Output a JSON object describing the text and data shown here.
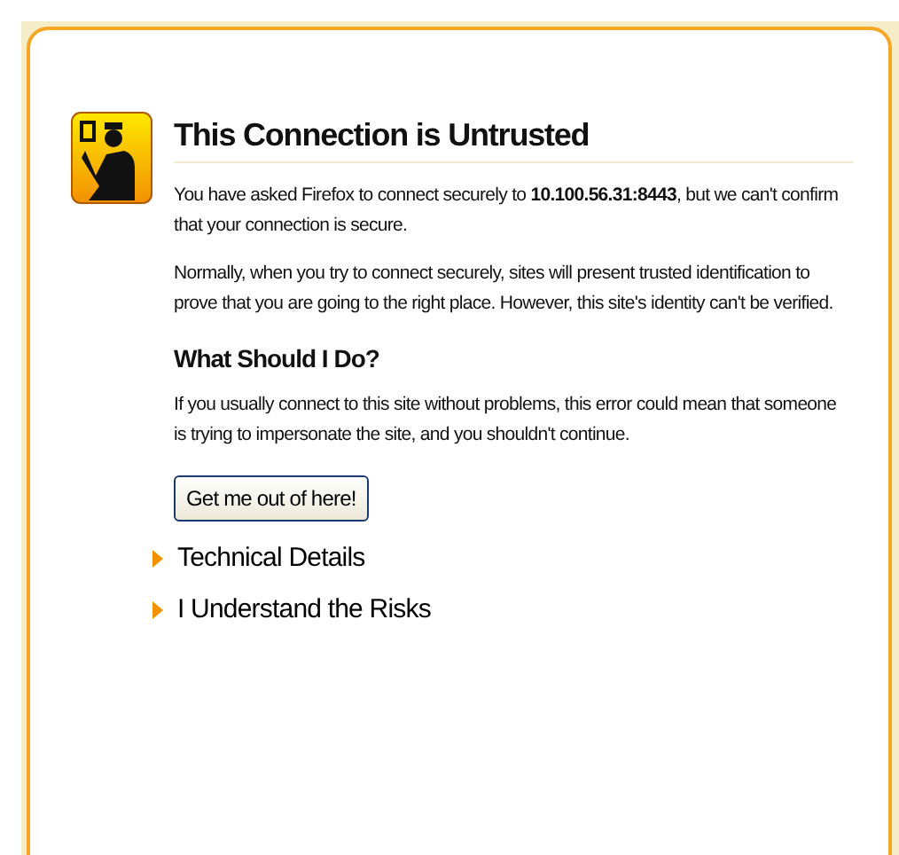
{
  "page": {
    "title": "This Connection is Untrusted",
    "paragraphs": [
      "You have asked Firefox to connect securely to **10.100.56.31:8443**, but we can't confirm that your connection is secure.",
      "Normally, when you try to connect securely, sites will present trusted identification to prove that you are going to the right place. However, this site's identity can't be verified."
    ],
    "section_heading": "What Should I Do?",
    "advice": "If you usually connect to this site without problems, this error could mean that someone is trying to impersonate the site, and you shouldn't continue.",
    "button": "Get me out of here!",
    "expanders": [
      {
        "label": "Technical Details",
        "expanded": false
      },
      {
        "label": "I Understand the Risks",
        "expanded": false
      }
    ]
  }
}
